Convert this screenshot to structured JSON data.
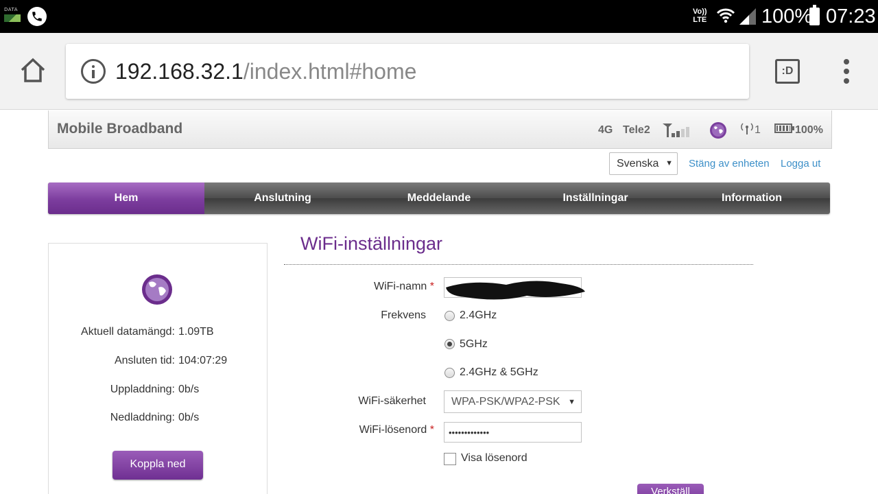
{
  "status_bar": {
    "data_label": "DATA",
    "volte_top": "Vo))",
    "volte_bottom": "LTE",
    "battery_percent": "100%",
    "time": "07:23"
  },
  "browser": {
    "url_host": "192.168.32.1",
    "url_path": "/index.html#home",
    "tab_switcher_label": ":D"
  },
  "router": {
    "title": "Mobile Broadband",
    "network_type": "4G",
    "operator": "Tele2",
    "wifi_clients": "1",
    "battery": "100%"
  },
  "top_bar": {
    "language": "Svenska",
    "shutdown_link": "Stäng av enheten",
    "logout_link": "Logga ut"
  },
  "nav": {
    "tabs": [
      {
        "label": "Hem",
        "active": true
      },
      {
        "label": "Anslutning",
        "active": false
      },
      {
        "label": "Meddelande",
        "active": false
      },
      {
        "label": "Inställningar",
        "active": false
      },
      {
        "label": "Information",
        "active": false
      }
    ]
  },
  "status_panel": {
    "rows": [
      {
        "label": "Aktuell datamängd:",
        "value": "1.09TB"
      },
      {
        "label": "Ansluten tid:",
        "value": "104:07:29"
      },
      {
        "label": "Uppladdning:",
        "value": "0b/s"
      },
      {
        "label": "Nedladdning:",
        "value": "0b/s"
      }
    ],
    "disconnect_button": "Koppla ned"
  },
  "wifi": {
    "title": "WiFi-inställningar",
    "name_label": "WiFi-namn",
    "required_mark": "*",
    "frequency_label": "Frekvens",
    "frequency_options": [
      "2.4GHz",
      "5GHz",
      "2.4GHz & 5GHz"
    ],
    "frequency_selected": "5GHz",
    "security_label": "WiFi-säkerhet",
    "security_value": "WPA-PSK/WPA2-PSK",
    "password_label": "WiFi-lösenord",
    "password_mask": "•••••••••••••",
    "show_password_label": "Visa lösenord",
    "show_password_checked": false,
    "apply_button": "Verkställ"
  },
  "colors": {
    "accent_purple": "#6b2d8c",
    "link_blue": "#3c8fc8",
    "required_red": "#c81e1e"
  }
}
